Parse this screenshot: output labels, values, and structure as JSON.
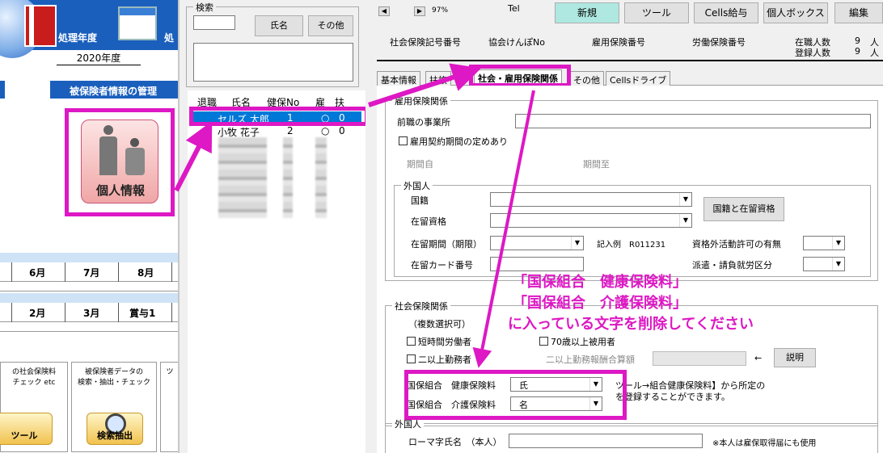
{
  "left_panel": {
    "nendo_label": "処理年度",
    "nendo_label_cut": "処",
    "year": "2020年度",
    "mgmt_header": "被保険者情報の管理",
    "person_button_label": "個人情報",
    "months_row1": [
      "6月",
      "7月",
      "8月"
    ],
    "months_row2": [
      "2月",
      "3月",
      "賞与1"
    ],
    "tool1_text": [
      "の社会保険料",
      "チェック etc"
    ],
    "tool1_label": "ツール",
    "tool2_text": [
      "被保険者データの",
      "検索・抽出・チェック"
    ],
    "tool2_label": "検索抽出",
    "tool3_text": "ツ"
  },
  "search_panel": {
    "title": "検索",
    "name_button": "氏名",
    "other_button": "その他",
    "search_value": "",
    "headers": [
      "退職",
      "氏名",
      "健保No",
      "雇",
      "扶"
    ],
    "employees": [
      {
        "name": "セルズ 太郎",
        "no": "1",
        "koyo": "○",
        "fuyo": "0"
      },
      {
        "name": "小牧 花子",
        "no": "2",
        "koyo": "○",
        "fuyo": "0"
      }
    ]
  },
  "right_panel": {
    "nav_prev": "◀",
    "nav_next": "▶",
    "zoom": "97%",
    "tel_label": "Tel",
    "top_buttons": [
      "新規",
      "ツール",
      "Cells給与",
      "個人ボックス",
      "編集"
    ],
    "insurance_labels": [
      "社会保険記号番号",
      "協会けんぽNo",
      "雇用保険番号",
      "労働保険番号"
    ],
    "count_labels": [
      {
        "label": "在職人数",
        "value": "9",
        "unit": "人"
      },
      {
        "label": "登録人数",
        "value": "9",
        "unit": "人"
      }
    ],
    "tabs": [
      "基本情報",
      "扶",
      "社会・雇用保険関係",
      "その他",
      "Cellsドライブ"
    ],
    "tab_partial": "族",
    "active_tab": "社会・雇用保険関係",
    "employment": {
      "title": "雇用保険関係",
      "prev_employer": "前職の事業所",
      "fixed_term": "雇用契約期間の定めあり",
      "period_from": "期間自",
      "period_to": "期間至"
    },
    "foreigner": {
      "title": "外国人",
      "nationality": "国籍",
      "residence_status": "在留資格",
      "nat_button": "国籍と在留資格",
      "residence_period": "在留期間（期限）",
      "example": "記入例　R011231",
      "outside_activity": "資格外活動許可の有無",
      "card_number": "在留カード番号",
      "dispatch": "派遣・請負就労区分"
    },
    "social": {
      "title": "社会保険関係",
      "multi_select": "（複数選択可）",
      "short_time": "短時間労働者",
      "over70": "70歳以上被用者",
      "multi_office": "二以上勤務者",
      "multi_office_calc": "二以上勤務報酬合算額",
      "arrow": "←",
      "explain_button": "説明",
      "kokuho_health_label": "国保組合　健康保険料",
      "kokuho_health_value": "氏",
      "kokuho_care_label": "国保組合　介護保険料",
      "kokuho_care_value": "名",
      "note1": "ツール→組合健康保険料】から所定の",
      "note2": "を登録することができます。"
    },
    "foreigner2": {
      "title": "外国人",
      "roman_name": "ローマ字氏名　（本人）",
      "note": "※本人は雇保取得届にも使用"
    },
    "annotation": [
      "「国保組合　健康保険料」",
      "「国保組合　介護保険料」",
      "に入っている文字を削除してください"
    ]
  },
  "colors": {
    "highlight": "#dd18c4",
    "selection": "#0078d7",
    "header_blue": "#1b5fbd",
    "teal_button": "#aee8e0"
  }
}
